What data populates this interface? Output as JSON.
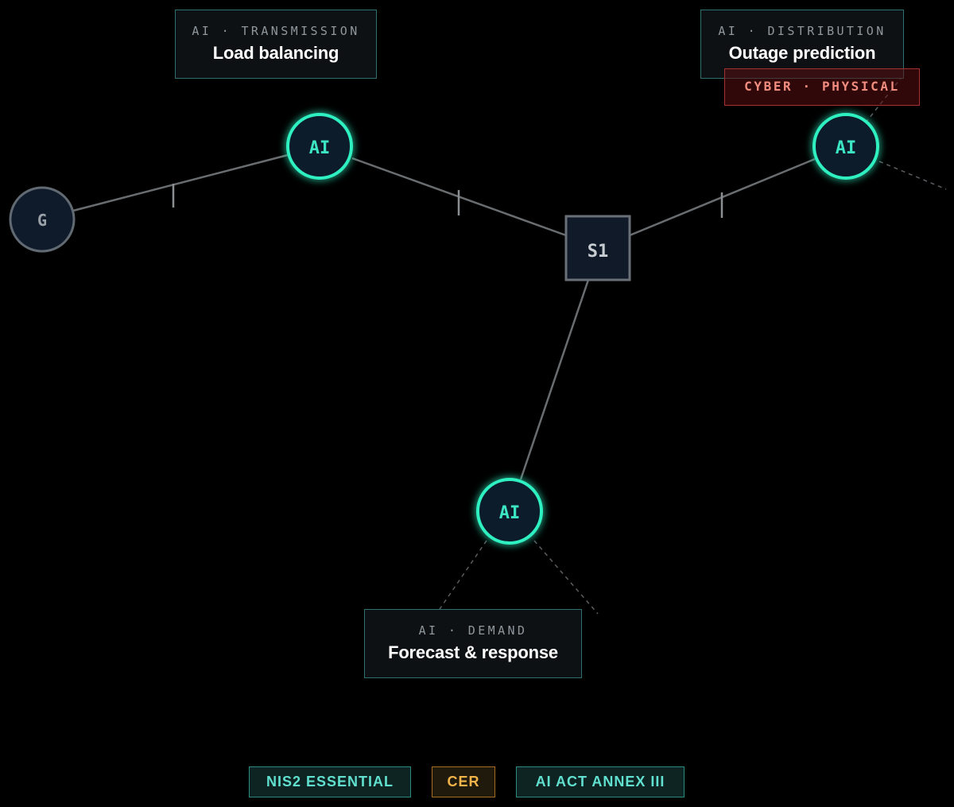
{
  "diagram": {
    "nodes": {
      "generator": {
        "label": "G"
      },
      "substation": {
        "label": "S1"
      },
      "ai_transmission": {
        "label": "AI"
      },
      "ai_distribution": {
        "label": "AI"
      },
      "ai_demand": {
        "label": "AI"
      }
    },
    "callouts": {
      "transmission": {
        "kicker": "AI · TRANSMISSION",
        "title": "Load balancing"
      },
      "distribution": {
        "kicker": "AI · DISTRIBUTION",
        "title": "Outage prediction"
      },
      "demand": {
        "kicker": "AI · DEMAND",
        "title": "Forecast & response"
      }
    },
    "risk_badge": {
      "label": "CYBER · PHYSICAL"
    }
  },
  "regulations": {
    "nis2": "NIS2 ESSENTIAL",
    "cer": "CER",
    "ai_act": "AI ACT ANNEX III"
  },
  "colors": {
    "background": "#000000",
    "ai_node_ring": "#2ff0c0",
    "ai_node_text": "#3ce6c4",
    "node_fill": "#0e1a2a",
    "neutral_ring": "#616a72",
    "line": "#6a6d70",
    "risk": "#a23133"
  }
}
